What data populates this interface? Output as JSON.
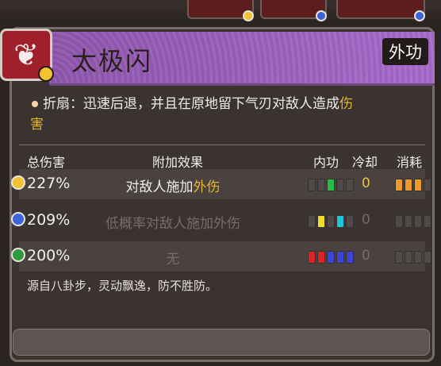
{
  "skill": {
    "title": "太极闪",
    "type": "外功",
    "desc_prefix": "折扇：迅速后退，并且在原地留下气刃对敌人造成",
    "desc_hl1": "伤",
    "desc_hl2": "害",
    "flavor": "源自八卦步，灵动飘逸，防不胜防。"
  },
  "table": {
    "headers": [
      "总伤害",
      "附加效果",
      "内功",
      "冷却",
      "消耗"
    ],
    "rows": [
      {
        "pct": "227%",
        "effect_prefix": "对敌人施加",
        "effect_hl": "外伤",
        "cooldown": "0",
        "dot": "#f2c230"
      },
      {
        "pct": "209%",
        "effect": "低概率对敌人施加外伤",
        "cooldown": "0",
        "dot": "#3c63d8"
      },
      {
        "pct": "200%",
        "effect": "无",
        "cooldown": "0",
        "dot": "#2f9a3f"
      }
    ]
  },
  "colors": {
    "accent": "#9b5fc0",
    "highlight": "#e5b433"
  }
}
